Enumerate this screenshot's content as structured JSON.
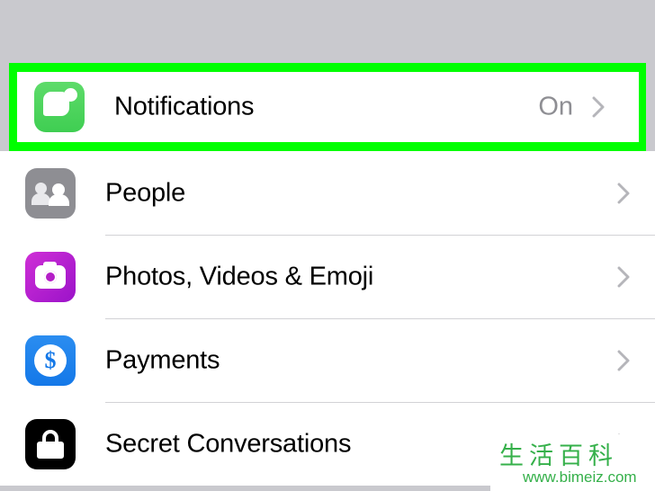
{
  "screen": {
    "background_color": "#c9c9ce",
    "highlight_color": "#00ff00"
  },
  "highlighted_row": {
    "label": "Notifications",
    "value": "On",
    "icon": "notifications-bubble-icon",
    "chevron": "chevron-right-icon",
    "icon_color": "#4cd25c"
  },
  "rows": [
    {
      "label": "People",
      "value": "",
      "icon": "people-icon",
      "icon_color": "#8e8e93",
      "chevron": "chevron-right-icon"
    },
    {
      "label": "Photos, Videos & Emoji",
      "value": "",
      "icon": "camera-icon",
      "icon_color": "#b41ec7",
      "chevron": "chevron-right-icon"
    },
    {
      "label": "Payments",
      "value": "",
      "icon": "dollar-icon",
      "icon_color": "#1478e8",
      "chevron": "chevron-right-icon"
    },
    {
      "label": "Secret Conversations",
      "value": "",
      "icon": "lock-icon",
      "icon_color": "#000000",
      "chevron": "chevron-right-icon"
    }
  ],
  "watermark": {
    "logo_text": "生活百科",
    "url": "www.bimeiz.com",
    "color": "#35b04a"
  }
}
